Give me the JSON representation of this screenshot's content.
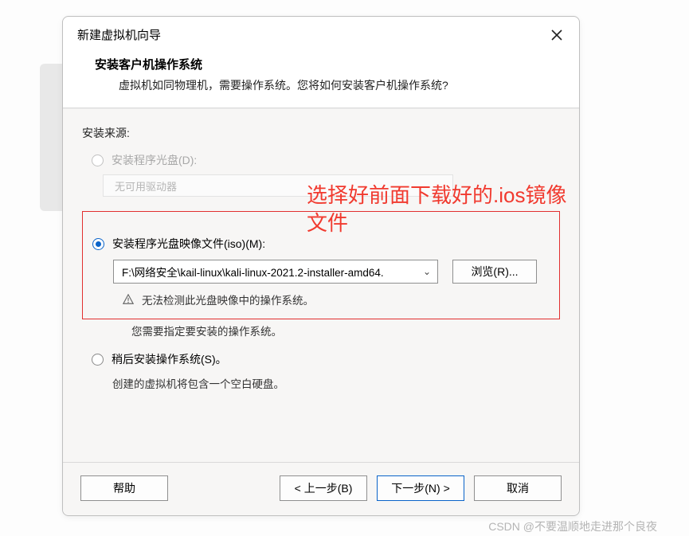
{
  "dialog": {
    "title": "新建虚拟机向导",
    "heading": "安装客户机操作系统",
    "subheading": "虚拟机如同物理机，需要操作系统。您将如何安装客户机操作系统?"
  },
  "source": {
    "section_label": "安装来源:",
    "disc": {
      "label": "安装程序光盘(D):",
      "placeholder": "无可用驱动器"
    },
    "iso": {
      "label": "安装程序光盘映像文件(iso)(M):",
      "path": "F:\\网络安全\\kail-linux\\kali-linux-2021.2-installer-amd64.",
      "browse": "浏览(R)...",
      "warn": "无法检测此光盘映像中的操作系统。",
      "note": "您需要指定要安装的操作系统。"
    },
    "later": {
      "label": "稍后安装操作系统(S)。",
      "note": "创建的虚拟机将包含一个空白硬盘。"
    }
  },
  "annotation": {
    "line1": "选择好前面下载好的.ios镜像",
    "line2": "文件"
  },
  "buttons": {
    "help": "帮助",
    "back": "< 上一步(B)",
    "next": "下一步(N) >",
    "cancel": "取消"
  },
  "watermark": "CSDN @不要温顺地走进那个良夜"
}
